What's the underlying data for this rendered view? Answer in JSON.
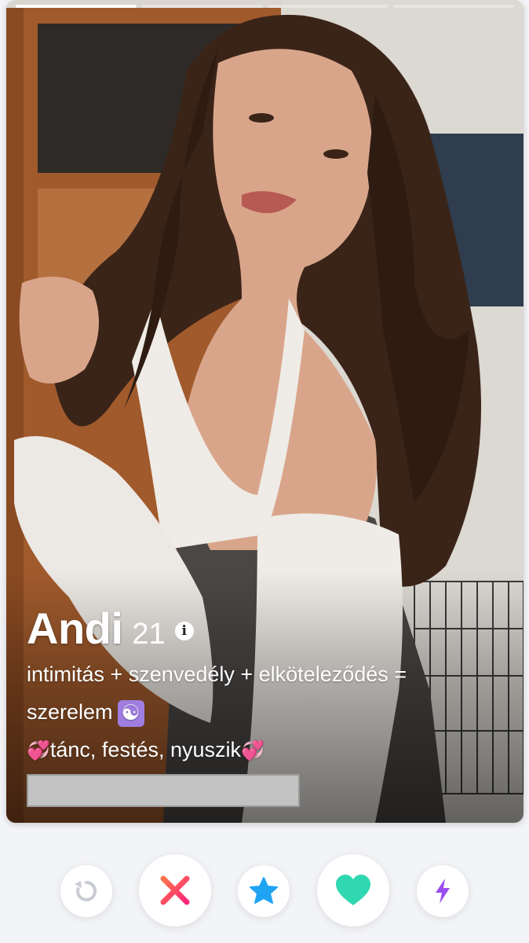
{
  "profile": {
    "name": "Andi",
    "age": "21",
    "info_icon": "i",
    "bio_line1": "intimitás + szenvedély + elköteleződés =",
    "bio_line2": "szerelem",
    "bio_line2_emoji": "☯",
    "bio_line3": "tánc, festés, nyuszik",
    "bio_line3_emoji": "💞",
    "photo_count": 4,
    "active_photo": 1
  },
  "actions": {
    "rewind_icon": "rewind-icon",
    "nope_icon": "close-icon",
    "superlike_icon": "star-icon",
    "like_icon": "heart-icon",
    "boost_icon": "lightning-icon"
  },
  "colors": {
    "rewind": "#c9ccd4",
    "nope": "#fd4e6a",
    "superlike": "#1fa4f4",
    "like": "#2fd8b1",
    "boost": "#9b4ef2",
    "yinyang_bg": "#9f7ee0",
    "hearts": "#e8449a"
  }
}
